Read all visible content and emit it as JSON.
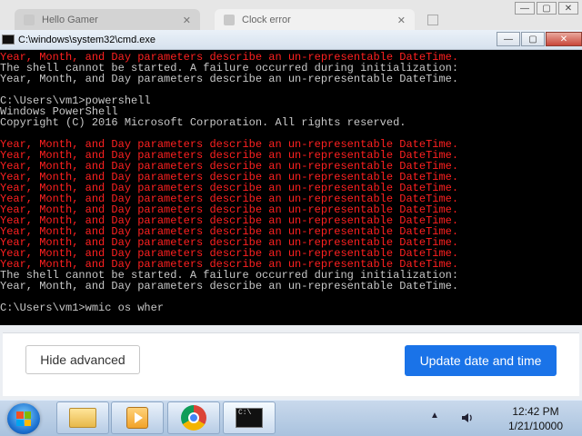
{
  "background_browser": {
    "tabs": [
      {
        "label": "Hello Gamer"
      },
      {
        "label": "Clock error"
      }
    ]
  },
  "cmd_window": {
    "title": "C:\\windows\\system32\\cmd.exe",
    "lines": [
      {
        "text": "Year, Month, and Day parameters describe an un-representable DateTime.",
        "color": "red"
      },
      {
        "text": "The shell cannot be started. A failure occurred during initialization:",
        "color": "gray"
      },
      {
        "text": "Year, Month, and Day parameters describe an un-representable DateTime.",
        "color": "gray"
      },
      {
        "text": "",
        "color": "gray"
      },
      {
        "text": "C:\\Users\\vm1>powershell",
        "color": "gray"
      },
      {
        "text": "Windows PowerShell",
        "color": "gray"
      },
      {
        "text": "Copyright (C) 2016 Microsoft Corporation. All rights reserved.",
        "color": "gray"
      },
      {
        "text": "",
        "color": "gray"
      },
      {
        "text": "Year, Month, and Day parameters describe an un-representable DateTime.",
        "color": "red"
      },
      {
        "text": "Year, Month, and Day parameters describe an un-representable DateTime.",
        "color": "red"
      },
      {
        "text": "Year, Month, and Day parameters describe an un-representable DateTime.",
        "color": "red"
      },
      {
        "text": "Year, Month, and Day parameters describe an un-representable DateTime.",
        "color": "red"
      },
      {
        "text": "Year, Month, and Day parameters describe an un-representable DateTime.",
        "color": "red"
      },
      {
        "text": "Year, Month, and Day parameters describe an un-representable DateTime.",
        "color": "red"
      },
      {
        "text": "Year, Month, and Day parameters describe an un-representable DateTime.",
        "color": "red"
      },
      {
        "text": "Year, Month, and Day parameters describe an un-representable DateTime.",
        "color": "red"
      },
      {
        "text": "Year, Month, and Day parameters describe an un-representable DateTime.",
        "color": "red"
      },
      {
        "text": "Year, Month, and Day parameters describe an un-representable DateTime.",
        "color": "red"
      },
      {
        "text": "Year, Month, and Day parameters describe an un-representable DateTime.",
        "color": "red"
      },
      {
        "text": "Year, Month, and Day parameters describe an un-representable DateTime.",
        "color": "red"
      },
      {
        "text": "The shell cannot be started. A failure occurred during initialization:",
        "color": "gray"
      },
      {
        "text": "Year, Month, and Day parameters describe an un-representable DateTime.",
        "color": "gray"
      },
      {
        "text": "",
        "color": "gray"
      },
      {
        "text": "C:\\Users\\vm1>wmic os wher",
        "color": "gray"
      }
    ]
  },
  "banner": {
    "hide_advanced_label": "Hide advanced",
    "update_label": "Update date and time",
    "accent_color": "#1a73e8"
  },
  "taskbar": {
    "apps": [
      "windows-explorer",
      "media-player",
      "chrome",
      "command-prompt"
    ],
    "time": "12:42 PM",
    "date": "1/21/10000"
  }
}
